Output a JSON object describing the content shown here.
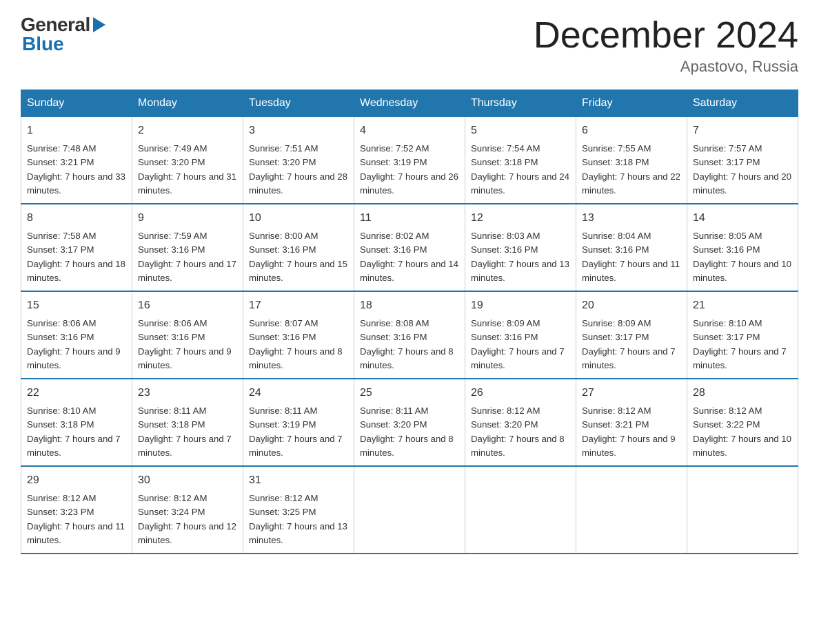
{
  "logo": {
    "general": "General",
    "blue": "Blue",
    "triangle": "▶"
  },
  "title": {
    "month_year": "December 2024",
    "location": "Apastovo, Russia"
  },
  "headers": [
    "Sunday",
    "Monday",
    "Tuesday",
    "Wednesday",
    "Thursday",
    "Friday",
    "Saturday"
  ],
  "weeks": [
    [
      {
        "day": "1",
        "sunrise": "7:48 AM",
        "sunset": "3:21 PM",
        "daylight": "7 hours and 33 minutes."
      },
      {
        "day": "2",
        "sunrise": "7:49 AM",
        "sunset": "3:20 PM",
        "daylight": "7 hours and 31 minutes."
      },
      {
        "day": "3",
        "sunrise": "7:51 AM",
        "sunset": "3:20 PM",
        "daylight": "7 hours and 28 minutes."
      },
      {
        "day": "4",
        "sunrise": "7:52 AM",
        "sunset": "3:19 PM",
        "daylight": "7 hours and 26 minutes."
      },
      {
        "day": "5",
        "sunrise": "7:54 AM",
        "sunset": "3:18 PM",
        "daylight": "7 hours and 24 minutes."
      },
      {
        "day": "6",
        "sunrise": "7:55 AM",
        "sunset": "3:18 PM",
        "daylight": "7 hours and 22 minutes."
      },
      {
        "day": "7",
        "sunrise": "7:57 AM",
        "sunset": "3:17 PM",
        "daylight": "7 hours and 20 minutes."
      }
    ],
    [
      {
        "day": "8",
        "sunrise": "7:58 AM",
        "sunset": "3:17 PM",
        "daylight": "7 hours and 18 minutes."
      },
      {
        "day": "9",
        "sunrise": "7:59 AM",
        "sunset": "3:16 PM",
        "daylight": "7 hours and 17 minutes."
      },
      {
        "day": "10",
        "sunrise": "8:00 AM",
        "sunset": "3:16 PM",
        "daylight": "7 hours and 15 minutes."
      },
      {
        "day": "11",
        "sunrise": "8:02 AM",
        "sunset": "3:16 PM",
        "daylight": "7 hours and 14 minutes."
      },
      {
        "day": "12",
        "sunrise": "8:03 AM",
        "sunset": "3:16 PM",
        "daylight": "7 hours and 13 minutes."
      },
      {
        "day": "13",
        "sunrise": "8:04 AM",
        "sunset": "3:16 PM",
        "daylight": "7 hours and 11 minutes."
      },
      {
        "day": "14",
        "sunrise": "8:05 AM",
        "sunset": "3:16 PM",
        "daylight": "7 hours and 10 minutes."
      }
    ],
    [
      {
        "day": "15",
        "sunrise": "8:06 AM",
        "sunset": "3:16 PM",
        "daylight": "7 hours and 9 minutes."
      },
      {
        "day": "16",
        "sunrise": "8:06 AM",
        "sunset": "3:16 PM",
        "daylight": "7 hours and 9 minutes."
      },
      {
        "day": "17",
        "sunrise": "8:07 AM",
        "sunset": "3:16 PM",
        "daylight": "7 hours and 8 minutes."
      },
      {
        "day": "18",
        "sunrise": "8:08 AM",
        "sunset": "3:16 PM",
        "daylight": "7 hours and 8 minutes."
      },
      {
        "day": "19",
        "sunrise": "8:09 AM",
        "sunset": "3:16 PM",
        "daylight": "7 hours and 7 minutes."
      },
      {
        "day": "20",
        "sunrise": "8:09 AM",
        "sunset": "3:17 PM",
        "daylight": "7 hours and 7 minutes."
      },
      {
        "day": "21",
        "sunrise": "8:10 AM",
        "sunset": "3:17 PM",
        "daylight": "7 hours and 7 minutes."
      }
    ],
    [
      {
        "day": "22",
        "sunrise": "8:10 AM",
        "sunset": "3:18 PM",
        "daylight": "7 hours and 7 minutes."
      },
      {
        "day": "23",
        "sunrise": "8:11 AM",
        "sunset": "3:18 PM",
        "daylight": "7 hours and 7 minutes."
      },
      {
        "day": "24",
        "sunrise": "8:11 AM",
        "sunset": "3:19 PM",
        "daylight": "7 hours and 7 minutes."
      },
      {
        "day": "25",
        "sunrise": "8:11 AM",
        "sunset": "3:20 PM",
        "daylight": "7 hours and 8 minutes."
      },
      {
        "day": "26",
        "sunrise": "8:12 AM",
        "sunset": "3:20 PM",
        "daylight": "7 hours and 8 minutes."
      },
      {
        "day": "27",
        "sunrise": "8:12 AM",
        "sunset": "3:21 PM",
        "daylight": "7 hours and 9 minutes."
      },
      {
        "day": "28",
        "sunrise": "8:12 AM",
        "sunset": "3:22 PM",
        "daylight": "7 hours and 10 minutes."
      }
    ],
    [
      {
        "day": "29",
        "sunrise": "8:12 AM",
        "sunset": "3:23 PM",
        "daylight": "7 hours and 11 minutes."
      },
      {
        "day": "30",
        "sunrise": "8:12 AM",
        "sunset": "3:24 PM",
        "daylight": "7 hours and 12 minutes."
      },
      {
        "day": "31",
        "sunrise": "8:12 AM",
        "sunset": "3:25 PM",
        "daylight": "7 hours and 13 minutes."
      },
      null,
      null,
      null,
      null
    ]
  ]
}
